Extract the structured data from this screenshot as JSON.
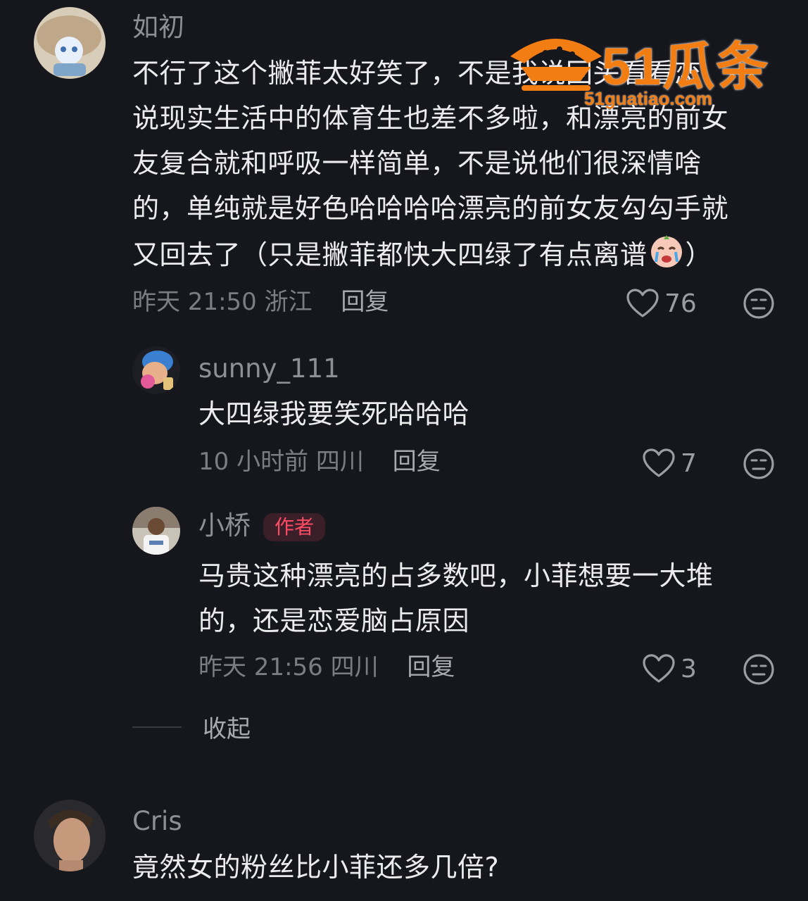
{
  "comments": [
    {
      "username": "如初",
      "lines": [
        "不行了这个撇菲太好笑了，不是我说回头看看恋",
        "说现实生活中的体育生也差不多啦，和漂亮的前女",
        "友复合就和呼吸一样简单，不是说他们很深情啥",
        "的，单纯就是好色哈哈哈哈漂亮的前女友勾勾手就",
        "又回去了（只是撇菲都快大四绿了有点离谱"
      ],
      "line_end": "）",
      "time": "昨天 21:50",
      "location": "浙江",
      "reply_label": "回复",
      "likes": "76"
    },
    {
      "username": "sunny_111",
      "text": "大四绿我要笑死哈哈哈",
      "time": "10 小时前",
      "location": "四川",
      "reply_label": "回复",
      "likes": "7"
    },
    {
      "username": "小桥",
      "badge": "作者",
      "lines": [
        "马贵这种漂亮的占多数吧，小菲想要一大堆",
        "的，还是恋爱脑占原因"
      ],
      "time": "昨天 21:56",
      "location": "四川",
      "reply_label": "回复",
      "likes": "3"
    },
    {
      "username": "Cris",
      "text": "竟然女的粉丝比小菲还多几倍?"
    }
  ],
  "collapse_label": "收起",
  "watermark": {
    "title": "51瓜条",
    "url": "51guatiao.com"
  },
  "colors": {
    "background": "#16161d",
    "accent": "#ff4b64",
    "watermark": "#f27d12"
  },
  "icons": [
    "heart-icon",
    "dislike-face-icon",
    "crying-face-emoji"
  ]
}
